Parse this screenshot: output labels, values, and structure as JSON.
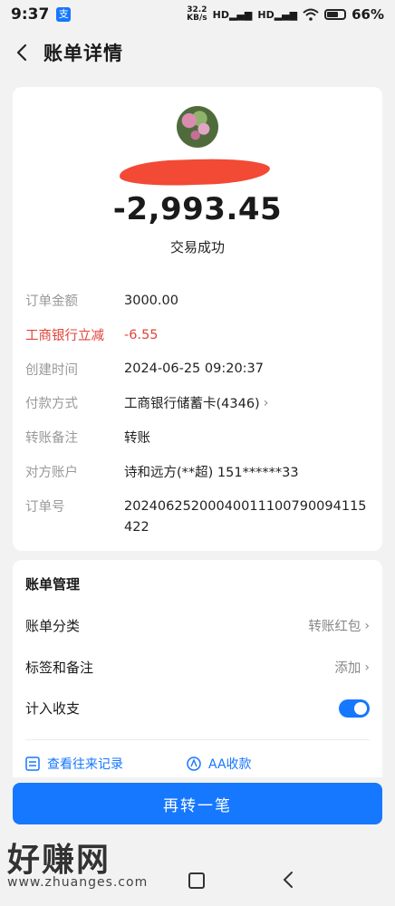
{
  "status_bar": {
    "time": "9:37",
    "app_badge": "支",
    "net_speed_value": "32.2",
    "net_speed_unit": "KB/s",
    "signal1": "HD",
    "signal2": "HD",
    "battery": "66%",
    "battery_level": 0.66
  },
  "header": {
    "title": "账单详情",
    "back_icon": "chevron-left-icon"
  },
  "summary": {
    "amount": "-2,993.45",
    "status": "交易成功"
  },
  "details": [
    {
      "label": "订单金额",
      "value": "3000.00"
    },
    {
      "label": "工商银行立减",
      "value": "-6.55"
    },
    {
      "label": "创建时间",
      "value": "2024-06-25 09:20:37"
    },
    {
      "label": "付款方式",
      "value": "工商银行储蓄卡(4346)"
    },
    {
      "label": "转账备注",
      "value": "转账"
    },
    {
      "label": "对方账户",
      "value": "诗和远方(**超) 151******33"
    },
    {
      "label": "订单号",
      "value": "20240625200040011100790094115422"
    }
  ],
  "management": {
    "title": "账单管理",
    "category_label": "账单分类",
    "category_value": "转账红包",
    "tags_label": "标签和备注",
    "tags_value": "添加",
    "income_label": "计入收支",
    "income_enabled": true,
    "link_history": "查看往来记录",
    "link_aa": "AA收款"
  },
  "cta": {
    "label": "再转一笔"
  },
  "watermark": {
    "title": "好赚网",
    "url": "www.zhuanges.com"
  },
  "colors": {
    "accent": "#1677ff",
    "discount": "#e0443c"
  }
}
